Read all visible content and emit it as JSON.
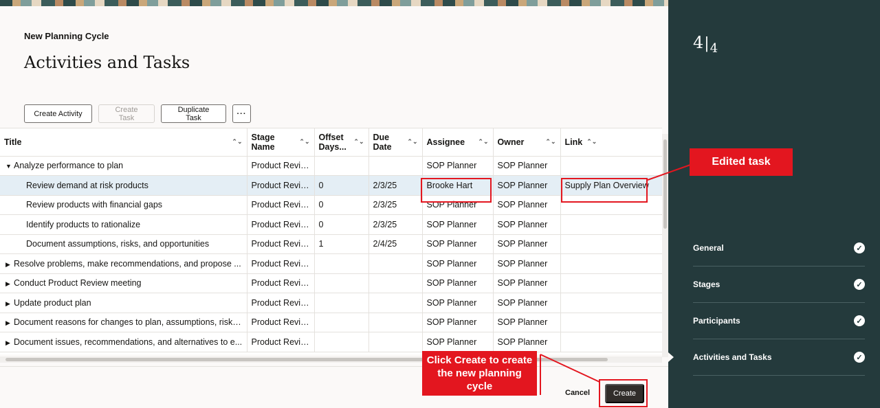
{
  "header": {
    "cycle_title": "New Planning Cycle",
    "page_title": "Activities and Tasks"
  },
  "toolbar": {
    "create_activity": "Create Activity",
    "create_task": "Create Task",
    "duplicate_task": "Duplicate Task",
    "more": "···"
  },
  "table": {
    "columns": [
      "Title",
      "Stage Name",
      "Offset Days...",
      "Due Date",
      "Assignee",
      "Owner",
      "Link"
    ],
    "column_lines": {
      "stage_1": "Stage",
      "stage_2": "Name",
      "offset_1": "Offset",
      "offset_2": "Days...",
      "due_1": "Due",
      "due_2": "Date"
    },
    "rows": [
      {
        "title": "Analyze performance to plan",
        "stage": "Product Review",
        "offset": "",
        "due": "",
        "assignee": "SOP Planner",
        "owner": "SOP Planner",
        "link": ""
      },
      {
        "title": "Review demand at risk products",
        "stage": "Product Review",
        "offset": "0",
        "due": "2/3/25",
        "assignee": "Brooke Hart",
        "owner": "SOP Planner",
        "link": "Supply Plan Overview"
      },
      {
        "title": "Review products with financial gaps",
        "stage": "Product Review",
        "offset": "0",
        "due": "2/3/25",
        "assignee": "SOP Planner",
        "owner": "SOP Planner",
        "link": ""
      },
      {
        "title": "Identify products to rationalize",
        "stage": "Product Review",
        "offset": "0",
        "due": "2/3/25",
        "assignee": "SOP Planner",
        "owner": "SOP Planner",
        "link": ""
      },
      {
        "title": "Document assumptions, risks, and opportunities",
        "stage": "Product Review",
        "offset": "1",
        "due": "2/4/25",
        "assignee": "SOP Planner",
        "owner": "SOP Planner",
        "link": ""
      },
      {
        "title": "Resolve problems, make recommendations, and propose ...",
        "stage": "Product Review",
        "offset": "",
        "due": "",
        "assignee": "SOP Planner",
        "owner": "SOP Planner",
        "link": ""
      },
      {
        "title": "Conduct Product Review meeting",
        "stage": "Product Review",
        "offset": "",
        "due": "",
        "assignee": "SOP Planner",
        "owner": "SOP Planner",
        "link": ""
      },
      {
        "title": "Update product plan",
        "stage": "Product Review",
        "offset": "",
        "due": "",
        "assignee": "SOP Planner",
        "owner": "SOP Planner",
        "link": ""
      },
      {
        "title": "Document reasons for changes to plan, assumptions, risks...",
        "stage": "Product Review",
        "offset": "",
        "due": "",
        "assignee": "SOP Planner",
        "owner": "SOP Planner",
        "link": ""
      },
      {
        "title": "Document issues, recommendations, and alternatives to e...",
        "stage": "Product Review",
        "offset": "",
        "due": "",
        "assignee": "SOP Planner",
        "owner": "SOP Planner",
        "link": ""
      }
    ]
  },
  "footer": {
    "cancel": "Cancel",
    "create": "Create"
  },
  "side": {
    "step_current": "4",
    "step_total": "4",
    "steps": [
      {
        "label": "General"
      },
      {
        "label": "Stages"
      },
      {
        "label": "Participants"
      },
      {
        "label": "Activities and Tasks"
      }
    ]
  },
  "annotations": {
    "edited_task": "Edited task",
    "create_note": "Click Create to create the new planning cycle"
  },
  "colors": {
    "accent_red": "#e3161f",
    "side_panel": "#243a3c",
    "selected_row": "#e4eef5",
    "create_button": "#312d2a"
  }
}
